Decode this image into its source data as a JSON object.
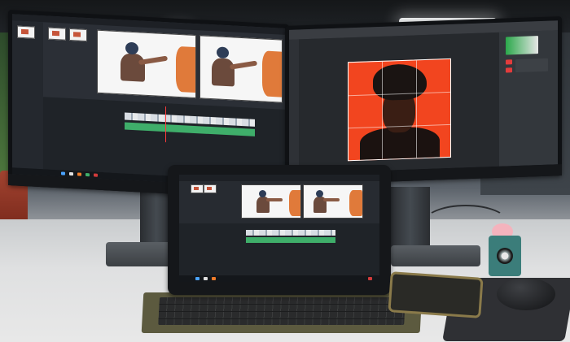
{
  "scene": {
    "description_items": [
      "left-monitor",
      "right-monitor",
      "tablet",
      "keyboard-cover",
      "phone",
      "mouse",
      "mouse-pad",
      "toy-camera"
    ]
  },
  "colors": {
    "portrait_background": "#f2451f",
    "audio_track": "#3fae6a",
    "editor_dark": "#2b2f36",
    "keyboard_cover": "#5c5a3f"
  }
}
